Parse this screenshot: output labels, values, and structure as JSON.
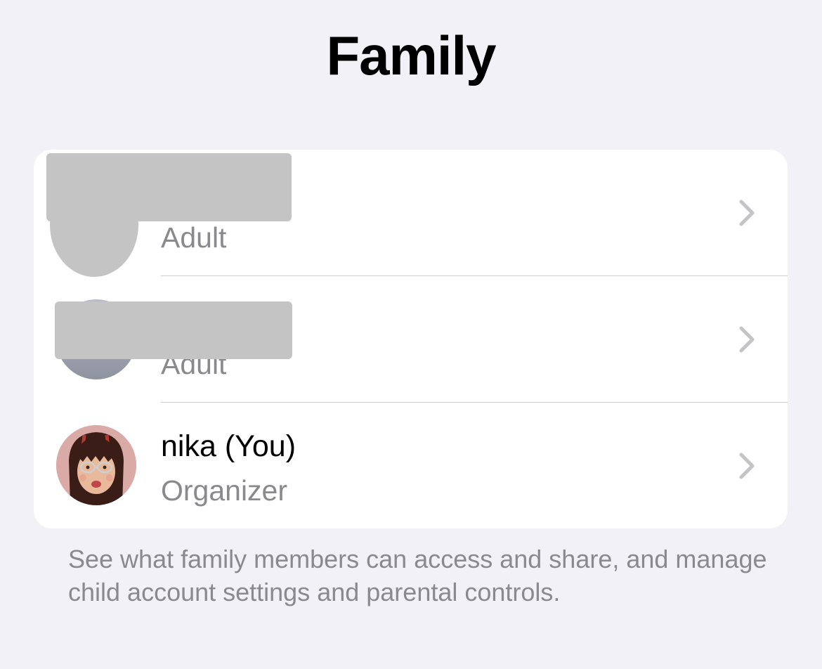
{
  "header": {
    "title": "Family"
  },
  "members": [
    {
      "name": "",
      "role": "Adult",
      "name_redacted": true,
      "avatar": "redacted-avatar"
    },
    {
      "name": "",
      "role": "Adult",
      "name_redacted": true,
      "avatar": "grey-avatar"
    },
    {
      "name": "nika (You)",
      "role": "Organizer",
      "name_redacted": false,
      "avatar": "memoji-avatar"
    }
  ],
  "icons": {
    "disclosure": "chevron-right-icon"
  },
  "footer": {
    "text": "See what family members can access and share, and manage child account settings and parental controls."
  },
  "colors": {
    "background": "#f2f1f7",
    "card": "#ffffff",
    "secondary_text": "#8a8a8e",
    "redaction": "#c4c4c4",
    "chevron": "#c4c4c7"
  }
}
